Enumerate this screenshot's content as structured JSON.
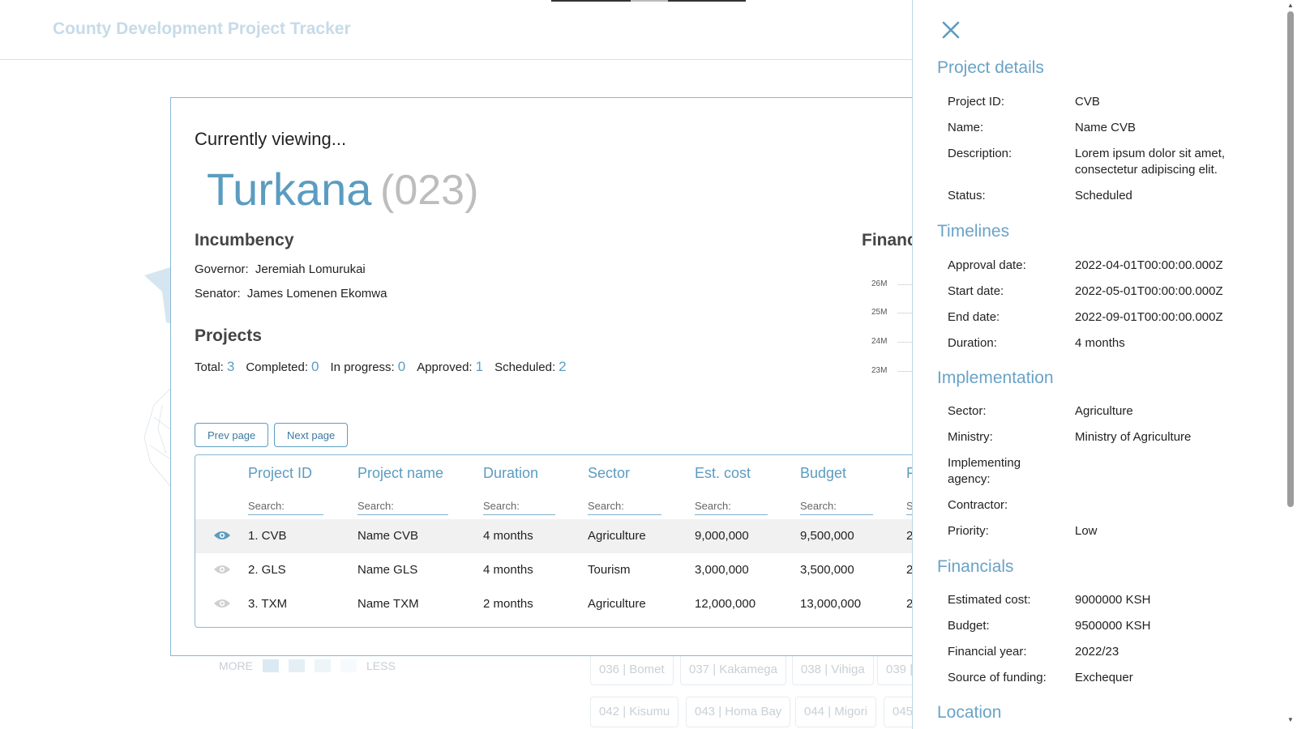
{
  "app": {
    "title": "County Development Project Tracker"
  },
  "colors": {
    "accent": "#5b9cc0",
    "muted": "#bdbdbd",
    "border": "#8ab8d4"
  },
  "legend": {
    "more": "MORE",
    "less": "LESS"
  },
  "county_buttons": [
    "036 | Bomet",
    "037 | Kakamega",
    "038 | Vihiga",
    "039 |",
    "042 | Kisumu",
    "043 | Homa Bay",
    "044 | Migori",
    "045"
  ],
  "card": {
    "viewing": "Currently viewing...",
    "county_name": "Turkana",
    "county_code": "(023)",
    "incumbency_title": "Incumbency",
    "governor_label": "Governor:",
    "governor": "Jeremiah Lomurukai",
    "senator_label": "Senator:",
    "senator": "James Lomenen Ekomwa",
    "projects_title": "Projects",
    "stats": [
      {
        "label": "Total:",
        "value": "3"
      },
      {
        "label": "Completed:",
        "value": "0"
      },
      {
        "label": "In progress:",
        "value": "0"
      },
      {
        "label": "Approved:",
        "value": "1"
      },
      {
        "label": "Scheduled:",
        "value": "2"
      }
    ],
    "financials_title": "Financ",
    "fin_ticks": [
      "26M",
      "25M",
      "24M",
      "23M"
    ],
    "prev_page": "Prev page",
    "next_page": "Next page"
  },
  "table": {
    "headers": [
      "Project ID",
      "Project name",
      "Duration",
      "Sector",
      "Est. cost",
      "Budget",
      "F"
    ],
    "search_placeholder": "Search:",
    "rows": [
      {
        "id": "1. CVB",
        "name": "Name CVB",
        "duration": "4 months",
        "sector": "Agriculture",
        "est_cost": "9,000,000",
        "budget": "9,500,000",
        "fy": "2",
        "selected": true
      },
      {
        "id": "2. GLS",
        "name": "Name GLS",
        "duration": "4 months",
        "sector": "Tourism",
        "est_cost": "3,000,000",
        "budget": "3,500,000",
        "fy": "2",
        "selected": false
      },
      {
        "id": "3. TXM",
        "name": "Name TXM",
        "duration": "2 months",
        "sector": "Agriculture",
        "est_cost": "12,000,000",
        "budget": "13,000,000",
        "fy": "2",
        "selected": false
      }
    ]
  },
  "drawer": {
    "sections": {
      "details": "Project details",
      "timelines": "Timelines",
      "implementation": "Implementation",
      "financials": "Financials",
      "location": "Location"
    },
    "details": {
      "project_id_label": "Project ID:",
      "project_id": "CVB",
      "name_label": "Name:",
      "name": "Name CVB",
      "description_label": "Description:",
      "description": "Lorem ipsum dolor sit amet, consectetur adipiscing elit.",
      "status_label": "Status:",
      "status": "Scheduled"
    },
    "timelines": {
      "approval_label": "Approval date:",
      "approval": "2022-04-01T00:00:00.000Z",
      "start_label": "Start date:",
      "start": "2022-05-01T00:00:00.000Z",
      "end_label": "End date:",
      "end": "2022-09-01T00:00:00.000Z",
      "duration_label": "Duration:",
      "duration": "4 months"
    },
    "implementation": {
      "sector_label": "Sector:",
      "sector": "Agriculture",
      "ministry_label": "Ministry:",
      "ministry": "Ministry of Agriculture",
      "agency_label": "Implementing agency:",
      "agency": "",
      "contractor_label": "Contractor:",
      "contractor": "",
      "priority_label": "Priority:",
      "priority": "Low"
    },
    "financials": {
      "est_cost_label": "Estimated cost:",
      "est_cost": "9000000 KSH",
      "budget_label": "Budget:",
      "budget": "9500000 KSH",
      "fy_label": "Financial year:",
      "fy": "2022/23",
      "funding_label": "Source of funding:",
      "funding": "Exchequer"
    }
  }
}
